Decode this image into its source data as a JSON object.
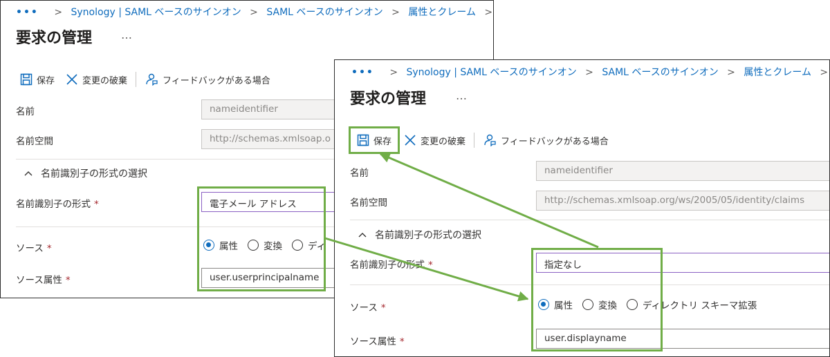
{
  "breadcrumb": {
    "ellipsis": "•••",
    "items": [
      "Synology | SAML ベースのサインオン",
      "SAML ベースのサインオン",
      "属性とクレーム"
    ],
    "separator": ">"
  },
  "page": {
    "title": "要求の管理",
    "more": "…"
  },
  "toolbar": {
    "save": "保存",
    "discard": "変更の破棄",
    "feedback": "フィードバックがある場合"
  },
  "form": {
    "name_label": "名前",
    "name_value": "nameidentifier",
    "namespace_label": "名前空間",
    "namespace_value": "http://schemas.xmlsoap.org/ws/2005/05/identity/claims",
    "section_label": "名前識別子の形式の選択",
    "format_label": "名前識別子の形式",
    "source_label": "ソース",
    "source_attr_label": "ソース属性",
    "required": "*",
    "source_options": [
      "属性",
      "変換",
      "ディレクトリ スキーマ拡張"
    ],
    "source_option_truncated": "ディ"
  },
  "before": {
    "format_value": "電子メール アドレス",
    "source_attr_value": "user.userprincipalname",
    "namespace_visible": "http://schemas.xmlsoap.o"
  },
  "after": {
    "format_value": "指定なし",
    "source_attr_value": "user.displayname"
  },
  "colors": {
    "accent": "#0f6cbd",
    "highlight_green": "#70ad47",
    "required_red": "#a4262c"
  }
}
